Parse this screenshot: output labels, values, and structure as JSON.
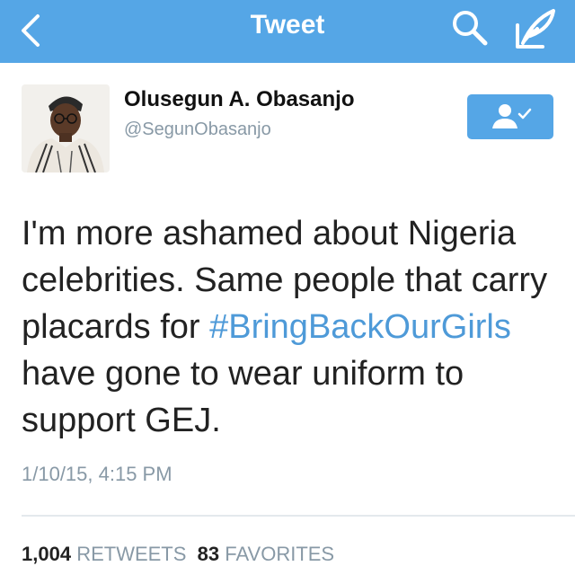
{
  "nav": {
    "title": "Tweet",
    "back_icon": "chevron-left-icon",
    "search_icon": "search-icon",
    "compose_icon": "compose-quill-icon",
    "bar_color": "#55a6e6"
  },
  "author": {
    "name": "Olusegun A. Obasanjo",
    "handle": "@SegunObasanjo",
    "follow_icon": "following-person-check-icon"
  },
  "tweet": {
    "text_before": "I'm more ashamed about Nigeria celebrities. Same people that carry placards for ",
    "hashtag": "#BringBackOurGirls",
    "text_after": " have gone to wear uniform to support GEJ.",
    "timestamp": "1/10/15, 4:15 PM",
    "hashtag_color": "#4e9ad8"
  },
  "stats": {
    "retweets_count": "1,004",
    "retweets_label": "RETWEETS",
    "favorites_count": "83",
    "favorites_label": "FAVORITES"
  }
}
